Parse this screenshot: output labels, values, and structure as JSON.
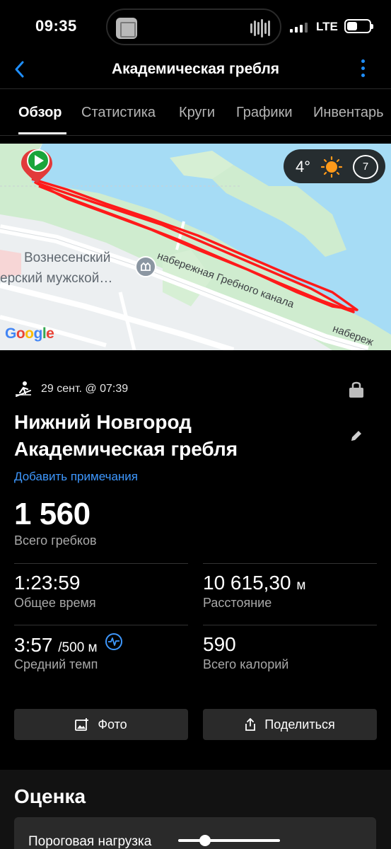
{
  "status_bar": {
    "time": "09:35",
    "network": "LTE",
    "icons": [
      "photo-thumbnail-icon",
      "audio-wave-icon",
      "cellular-signal-icon",
      "battery-icon"
    ]
  },
  "nav": {
    "back_icon": "chevron-left-icon",
    "title": "Академическая гребля",
    "more_icon": "vertical-dots-icon"
  },
  "tabs": [
    {
      "label": "Обзор",
      "active": true
    },
    {
      "label": "Статистика",
      "active": false
    },
    {
      "label": "Круги",
      "active": false
    },
    {
      "label": "Графики",
      "active": false
    },
    {
      "label": "Инвентарь",
      "active": false
    }
  ],
  "map": {
    "attribution": "Google",
    "poi_line1": "Вознесенский",
    "poi_line2": "ерский мужской…",
    "street_1": "набережная Гребного канала",
    "street_2": "набереж",
    "start_marker_icon": "play-pin-icon",
    "colors": {
      "water": "#a6dcf5",
      "park": "#cfeccf",
      "route": "#ff1a1a",
      "start": "#1aa53a"
    }
  },
  "weather": {
    "temperature": "4°",
    "icon": "sun-icon",
    "wind": "7"
  },
  "activity": {
    "icon": "rowing-icon",
    "date": "29 сент. @ 07:39",
    "lock_icon": "lock-icon",
    "title_line1": "Нижний Новгород",
    "title_line2": "Академическая гребля",
    "edit_icon": "pencil-icon",
    "add_notes": "Добавить примечания",
    "strokes_value": "1 560",
    "strokes_label": "Всего гребков"
  },
  "stats": {
    "total_time": {
      "value": "1:23:59",
      "label": "Общее время"
    },
    "distance": {
      "value": "10 615,30",
      "unit": "м",
      "label": "Расстояние"
    },
    "avg_pace": {
      "value": "3:57",
      "unit": "/500 м",
      "label": "Средний темп",
      "icon": "pace-chart-icon"
    },
    "calories": {
      "value": "590",
      "label": "Всего калорий"
    }
  },
  "buttons": {
    "photo": "Фото",
    "share": "Поделиться"
  },
  "rating": {
    "title": "Оценка",
    "card_label": "Пороговая нагрузка"
  }
}
